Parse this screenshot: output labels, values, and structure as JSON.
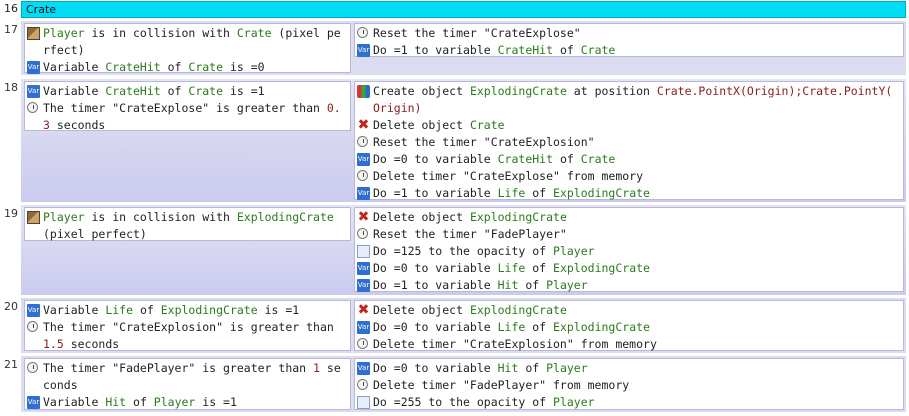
{
  "group": {
    "number": "16",
    "label": "Crate"
  },
  "events": [
    {
      "number": "17",
      "conditions": [
        {
          "icon": "object-icon",
          "parts": [
            [
              "obj",
              "Player"
            ],
            [
              "t",
              " is in collision with "
            ],
            [
              "obj",
              "Crate"
            ],
            [
              "t",
              " (pixel pe"
            ]
          ]
        },
        {
          "icon": "object-icon-cont",
          "parts": [
            [
              "t",
              "rfect)"
            ]
          ]
        },
        {
          "icon": "variable-icon",
          "parts": [
            [
              "t",
              "Variable "
            ],
            [
              "obj",
              "CrateHit"
            ],
            [
              "t",
              " of "
            ],
            [
              "obj",
              "Crate"
            ],
            [
              "t",
              " is =0"
            ]
          ]
        }
      ],
      "actions": [
        {
          "icon": "timer-icon",
          "parts": [
            [
              "t",
              "Reset the timer \"CrateExplose\""
            ]
          ]
        },
        {
          "icon": "variable-icon",
          "parts": [
            [
              "t",
              "Do =1 to variable "
            ],
            [
              "obj",
              "CrateHit"
            ],
            [
              "t",
              " of "
            ],
            [
              "obj",
              "Crate"
            ]
          ]
        }
      ]
    },
    {
      "number": "18",
      "conditions": [
        {
          "icon": "variable-icon",
          "parts": [
            [
              "t",
              "Variable "
            ],
            [
              "obj",
              "CrateHit"
            ],
            [
              "t",
              " of "
            ],
            [
              "obj",
              "Crate"
            ],
            [
              "t",
              " is =1"
            ]
          ]
        },
        {
          "icon": "timer-icon",
          "parts": [
            [
              "t",
              "The timer \"CrateExplose\" is greater than "
            ],
            [
              "val",
              "0."
            ]
          ]
        },
        {
          "icon": "none",
          "parts": [
            [
              "val",
              "3"
            ],
            [
              "t",
              " seconds"
            ]
          ]
        }
      ],
      "actions": [
        {
          "icon": "create-object-icon",
          "parts": [
            [
              "t",
              "Create object "
            ],
            [
              "obj",
              "ExplodingCrate"
            ],
            [
              "t",
              " at position "
            ],
            [
              "val",
              "Crate.PointX(Origin);Crate.PointY("
            ]
          ]
        },
        {
          "icon": "none",
          "parts": [
            [
              "val",
              "Origin)"
            ]
          ]
        },
        {
          "icon": "delete-icon",
          "parts": [
            [
              "t",
              "Delete object "
            ],
            [
              "obj",
              "Crate"
            ]
          ]
        },
        {
          "icon": "timer-icon",
          "parts": [
            [
              "t",
              "Reset the timer \"CrateExplosion\""
            ]
          ]
        },
        {
          "icon": "variable-icon",
          "parts": [
            [
              "t",
              "Do =0 to variable "
            ],
            [
              "obj",
              "CrateHit"
            ],
            [
              "t",
              " of "
            ],
            [
              "obj",
              "Crate"
            ]
          ]
        },
        {
          "icon": "timer-icon",
          "parts": [
            [
              "t",
              "Delete timer \"CrateExplose\" from memory"
            ]
          ]
        },
        {
          "icon": "variable-icon",
          "parts": [
            [
              "t",
              "Do =1 to variable "
            ],
            [
              "obj",
              "Life"
            ],
            [
              "t",
              " of "
            ],
            [
              "obj",
              "ExplodingCrate"
            ]
          ]
        }
      ]
    },
    {
      "number": "19",
      "conditions": [
        {
          "icon": "object-icon",
          "parts": [
            [
              "obj",
              "Player"
            ],
            [
              "t",
              " is in collision with "
            ],
            [
              "obj",
              "ExplodingCrate"
            ]
          ]
        },
        {
          "icon": "none",
          "parts": [
            [
              "t",
              "(pixel perfect)"
            ]
          ]
        }
      ],
      "actions": [
        {
          "icon": "delete-icon",
          "parts": [
            [
              "t",
              "Delete object "
            ],
            [
              "obj",
              "ExplodingCrate"
            ]
          ]
        },
        {
          "icon": "timer-icon",
          "parts": [
            [
              "t",
              "Reset the timer \"FadePlayer\""
            ]
          ]
        },
        {
          "icon": "opacity-icon",
          "parts": [
            [
              "t",
              "Do =125 to the opacity of "
            ],
            [
              "obj",
              "Player"
            ]
          ]
        },
        {
          "icon": "variable-icon",
          "parts": [
            [
              "t",
              "Do =0 to variable "
            ],
            [
              "obj",
              "Life"
            ],
            [
              "t",
              " of "
            ],
            [
              "obj",
              "ExplodingCrate"
            ]
          ]
        },
        {
          "icon": "variable-icon",
          "parts": [
            [
              "t",
              "Do =1 to variable "
            ],
            [
              "obj",
              "Hit"
            ],
            [
              "t",
              " of "
            ],
            [
              "obj",
              "Player"
            ]
          ]
        }
      ]
    },
    {
      "number": "20",
      "conditions": [
        {
          "icon": "variable-icon",
          "parts": [
            [
              "t",
              "Variable "
            ],
            [
              "obj",
              "Life"
            ],
            [
              "t",
              " of "
            ],
            [
              "obj",
              "ExplodingCrate"
            ],
            [
              "t",
              " is =1"
            ]
          ]
        },
        {
          "icon": "timer-icon",
          "parts": [
            [
              "t",
              "The timer \"CrateExplosion\" is greater than"
            ]
          ]
        },
        {
          "icon": "none",
          "parts": [
            [
              "val",
              "1.5"
            ],
            [
              "t",
              " seconds"
            ]
          ]
        }
      ],
      "actions": [
        {
          "icon": "delete-icon",
          "parts": [
            [
              "t",
              "Delete object "
            ],
            [
              "obj",
              "ExplodingCrate"
            ]
          ]
        },
        {
          "icon": "variable-icon",
          "parts": [
            [
              "t",
              "Do =0 to variable "
            ],
            [
              "obj",
              "Life"
            ],
            [
              "t",
              " of "
            ],
            [
              "obj",
              "ExplodingCrate"
            ]
          ]
        },
        {
          "icon": "timer-icon",
          "parts": [
            [
              "t",
              "Delete timer \"CrateExplosion\" from memory"
            ]
          ]
        }
      ]
    },
    {
      "number": "21",
      "conditions": [
        {
          "icon": "timer-icon",
          "parts": [
            [
              "t",
              "The timer \"FadePlayer\" is greater than "
            ],
            [
              "val",
              "1"
            ],
            [
              "t",
              " se"
            ]
          ]
        },
        {
          "icon": "none",
          "parts": [
            [
              "t",
              "conds"
            ]
          ]
        },
        {
          "icon": "variable-icon",
          "parts": [
            [
              "t",
              "Variable "
            ],
            [
              "obj",
              "Hit"
            ],
            [
              "t",
              " of "
            ],
            [
              "obj",
              "Player"
            ],
            [
              "t",
              " is =1"
            ]
          ]
        }
      ],
      "actions": [
        {
          "icon": "variable-icon",
          "parts": [
            [
              "t",
              "Do =0 to variable "
            ],
            [
              "obj",
              "Hit"
            ],
            [
              "t",
              " of "
            ],
            [
              "obj",
              "Player"
            ]
          ]
        },
        {
          "icon": "timer-icon",
          "parts": [
            [
              "t",
              "Delete timer \"FadePlayer\" from memory"
            ]
          ]
        },
        {
          "icon": "opacity-icon",
          "parts": [
            [
              "t",
              "Do =255 to the opacity of "
            ],
            [
              "obj",
              "Player"
            ]
          ]
        }
      ]
    }
  ]
}
